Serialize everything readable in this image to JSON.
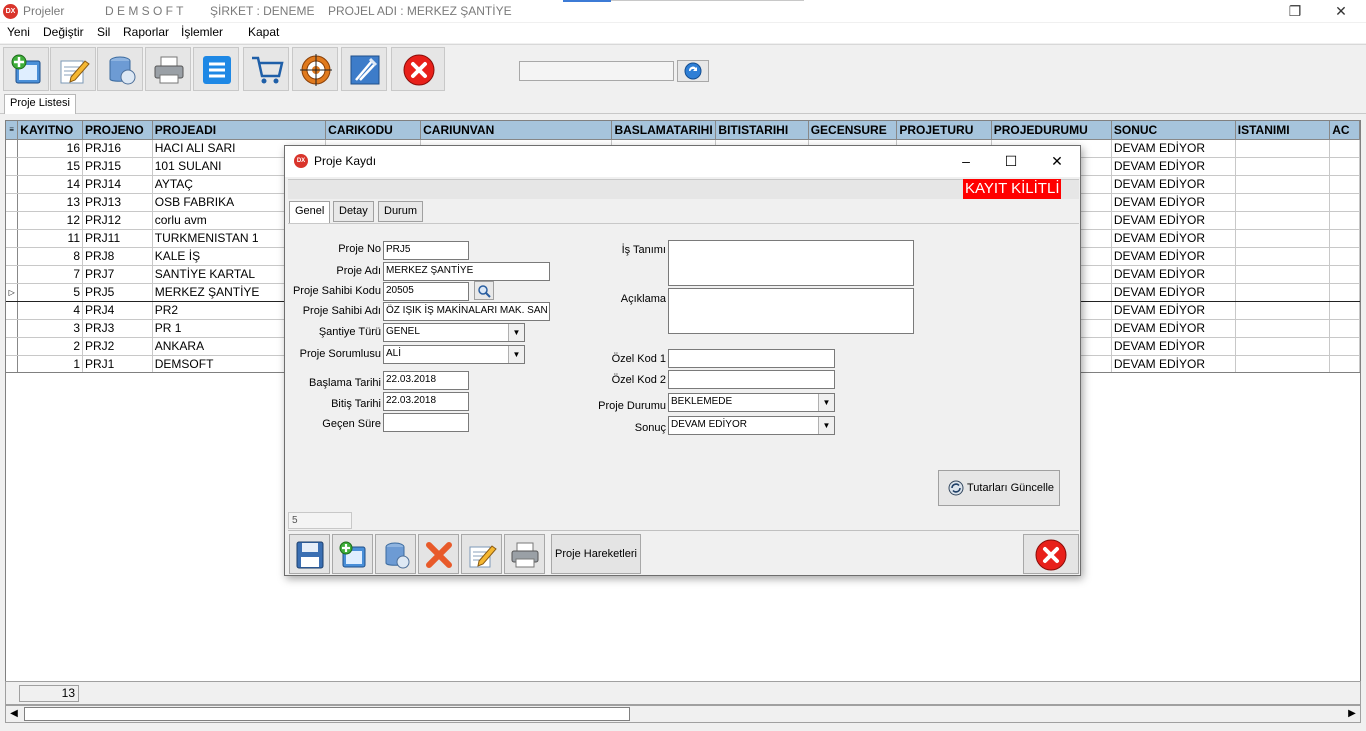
{
  "titlebar": {
    "app_name": "Projeler",
    "company": "D E M S O F T",
    "sirket": "ŞİRKET : DENEME",
    "proje": "PROJEL ADI : MERKEZ ŞANTİYE"
  },
  "menu": [
    "Yeni",
    "Değiştir",
    "Sil",
    "Raporlar",
    "İşlemler",
    "Kapat"
  ],
  "toolbar_icons": [
    "new-icon",
    "edit-icon",
    "delete-icon",
    "print-icon",
    "list-icon",
    "cart-icon",
    "target-icon",
    "tools-icon",
    "close-icon"
  ],
  "search": {
    "value": ""
  },
  "main_tab": "Proje Listesi",
  "grid": {
    "columns": [
      "KAYITNO",
      "PROJENO",
      "PROJEADI",
      "CARIKODU",
      "CARIUNVAN",
      "BASLAMATARIHI",
      "BITISTARIHI",
      "GECENSURE",
      "PROJETURU",
      "PROJEDURUMU",
      "SONUC",
      "ISTANIMI",
      "AC"
    ],
    "rows": [
      {
        "kayitno": "16",
        "projeno": "PRJ16",
        "projeadi": "HACI ALI SARI",
        "sonuc": "DEVAM EDİYOR"
      },
      {
        "kayitno": "15",
        "projeno": "PRJ15",
        "projeadi": "101 SULANI",
        "sonuc": "DEVAM EDİYOR"
      },
      {
        "kayitno": "14",
        "projeno": "PRJ14",
        "projeadi": "AYTAÇ",
        "sonuc": "DEVAM EDİYOR"
      },
      {
        "kayitno": "13",
        "projeno": "PRJ13",
        "projeadi": "OSB FABRIKA",
        "sonuc": "DEVAM EDİYOR"
      },
      {
        "kayitno": "12",
        "projeno": "PRJ12",
        "projeadi": "corlu avm",
        "sonuc": "DEVAM EDİYOR"
      },
      {
        "kayitno": "11",
        "projeno": "PRJ11",
        "projeadi": "TURKMENISTAN 1",
        "sonuc": "DEVAM EDİYOR"
      },
      {
        "kayitno": "8",
        "projeno": "PRJ8",
        "projeadi": "KALE İŞ",
        "sonuc": "DEVAM EDİYOR"
      },
      {
        "kayitno": "7",
        "projeno": "PRJ7",
        "projeadi": "SANTİYE KARTAL",
        "sonuc": "DEVAM EDİYOR"
      },
      {
        "kayitno": "5",
        "projeno": "PRJ5",
        "projeadi": "MERKEZ ŞANTİYE",
        "sonuc": "DEVAM EDİYOR"
      },
      {
        "kayitno": "4",
        "projeno": "PRJ4",
        "projeadi": "PR2",
        "sonuc": "DEVAM EDİYOR"
      },
      {
        "kayitno": "3",
        "projeno": "PRJ3",
        "projeadi": "PR 1",
        "sonuc": "DEVAM EDİYOR"
      },
      {
        "kayitno": "2",
        "projeno": "PRJ2",
        "projeadi": "ANKARA",
        "sonuc": "DEVAM EDİYOR"
      },
      {
        "kayitno": "1",
        "projeno": "PRJ1",
        "projeadi": "DEMSOFT",
        "sonuc": "DEVAM EDİYOR"
      }
    ],
    "selected_row": 8
  },
  "footer": {
    "record_count": "13"
  },
  "dialog": {
    "title": "Proje Kaydı",
    "lock_label": "KAYIT KİLİTLİ",
    "tabs": [
      "Genel",
      "Detay",
      "Durum"
    ],
    "labels": {
      "proje_no": "Proje No",
      "proje_adi": "Proje Adı",
      "sahibi_kodu": "Proje Sahibi Kodu",
      "sahibi_adi": "Proje Sahibi Adı",
      "santiye_turu": "Şantiye Türü",
      "sorumlu": "Proje Sorumlusu",
      "baslama": "Başlama Tarihi",
      "bitis": "Bitiş Tarihi",
      "gecen": "Geçen Süre",
      "is_tanimi": "İş Tanımı",
      "aciklama": "Açıklama",
      "ozel1": "Özel Kod 1",
      "ozel2": "Özel Kod 2",
      "durum": "Proje Durumu",
      "sonuc": "Sonuç"
    },
    "values": {
      "proje_no": "PRJ5",
      "proje_adi": "MERKEZ ŞANTİYE",
      "sahibi_kodu": "20505",
      "sahibi_adi": "ÖZ IŞIK İŞ MAKİNALARI MAK. SAN",
      "santiye_turu": "GENEL",
      "sorumlu": "ALİ",
      "baslama": "22.03.2018",
      "bitis": "22.03.2018",
      "gecen": "",
      "is_tanimi": "",
      "aciklama": "",
      "ozel1": "",
      "ozel2": "",
      "durum": "BEKLEMEDE",
      "sonuc": "DEVAM EDİYOR"
    },
    "update_button": "Tutarları Güncelle",
    "record_no": "5",
    "hareket_button": "Proje Hareketleri"
  }
}
